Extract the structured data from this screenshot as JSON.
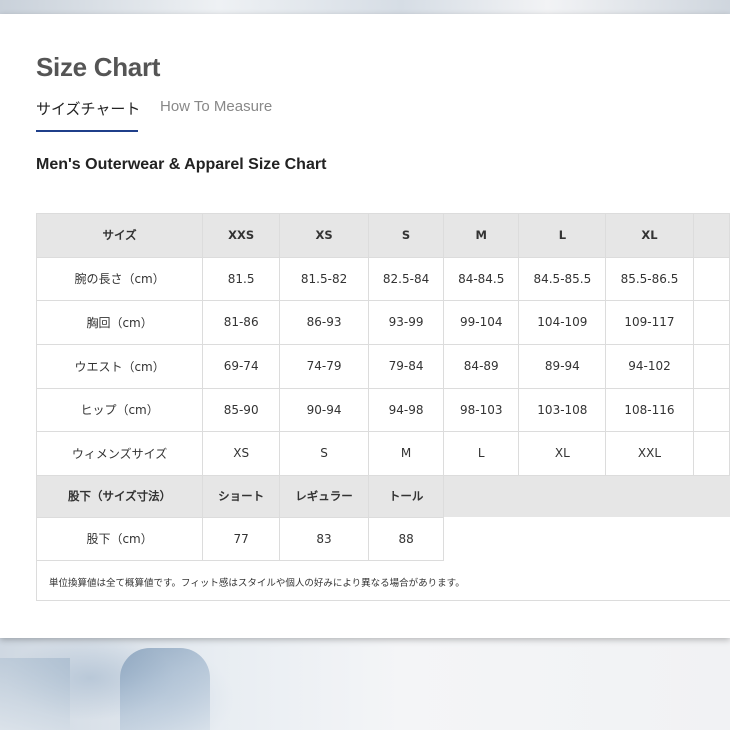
{
  "modal": {
    "title": "Size Chart",
    "tabs": [
      {
        "label": "サイズチャート",
        "active": true
      },
      {
        "label": "How To Measure",
        "active": false
      }
    ],
    "section_title": "Men's Outerwear & Apparel Size Chart",
    "accent_color": "#1f3f8a"
  },
  "size_table": {
    "header": [
      "サイズ",
      "XXS",
      "XS",
      "S",
      "M",
      "L",
      "XL"
    ],
    "rows": [
      [
        "腕の長さ（cm）",
        "81.5",
        "81.5-82",
        "82.5-84",
        "84-84.5",
        "84.5-85.5",
        "85.5-86.5"
      ],
      [
        "胸回（cm）",
        "81-86",
        "86-93",
        "93-99",
        "99-104",
        "104-109",
        "109-117"
      ],
      [
        "ウエスト（cm）",
        "69-74",
        "74-79",
        "79-84",
        "84-89",
        "89-94",
        "94-102"
      ],
      [
        "ヒップ（cm）",
        "85-90",
        "90-94",
        "94-98",
        "98-103",
        "103-108",
        "108-116"
      ],
      [
        "ウィメンズサイズ",
        "XS",
        "S",
        "M",
        "L",
        "XL",
        "XXL"
      ]
    ]
  },
  "inseam_table": {
    "header": [
      "股下（サイズ寸法）",
      "ショート",
      "レギュラー",
      "トール"
    ],
    "rows": [
      [
        "股下（cm）",
        "77",
        "83",
        "88"
      ]
    ]
  },
  "footnote": "単位換算値は全て概算値です。フィット感はスタイルや個人の好みにより異なる場合があります。"
}
